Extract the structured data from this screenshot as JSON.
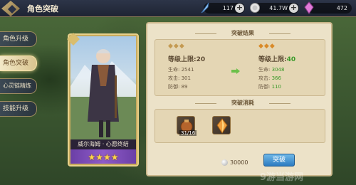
{
  "header": {
    "title": "角色突破",
    "resources": [
      {
        "icon": "feather-icon",
        "value": "117"
      },
      {
        "icon": "coin-icon",
        "value": "41.7W"
      },
      {
        "icon": "crystal-icon",
        "value": "472"
      }
    ]
  },
  "sidebar": {
    "tabs": [
      {
        "label": "角色升级"
      },
      {
        "label": "角色突破"
      },
      {
        "label": "心灵链精炼"
      },
      {
        "label": "技能升级"
      }
    ]
  },
  "character": {
    "name": "威尔海姆 · 心愿终结",
    "stars": "★★★★"
  },
  "result": {
    "title": "突破结果",
    "before": {
      "level": "等级上限:20",
      "hp": "生命: 2541",
      "atk": "攻击: 301",
      "def": "防御: 89"
    },
    "after": {
      "level_label": "等级上限:",
      "level_value": "40",
      "hp_label": "生命: ",
      "hp_value": "3048",
      "atk_label": "攻击: ",
      "atk_value": "366",
      "def_label": "防御: ",
      "def_value": "110"
    }
  },
  "cost": {
    "title": "突破消耗",
    "items": [
      {
        "icon": "medal-bag-icon",
        "qty": "31/16"
      },
      {
        "icon": "crystal-shard-icon",
        "qty": ""
      }
    ],
    "gold": "30000",
    "button": "突破"
  },
  "watermark": "9游当游网",
  "colors": {
    "accent_green": "#3b9a2a",
    "panel_bg": "#ece2c8",
    "button_blue": "#2c7bc0"
  }
}
